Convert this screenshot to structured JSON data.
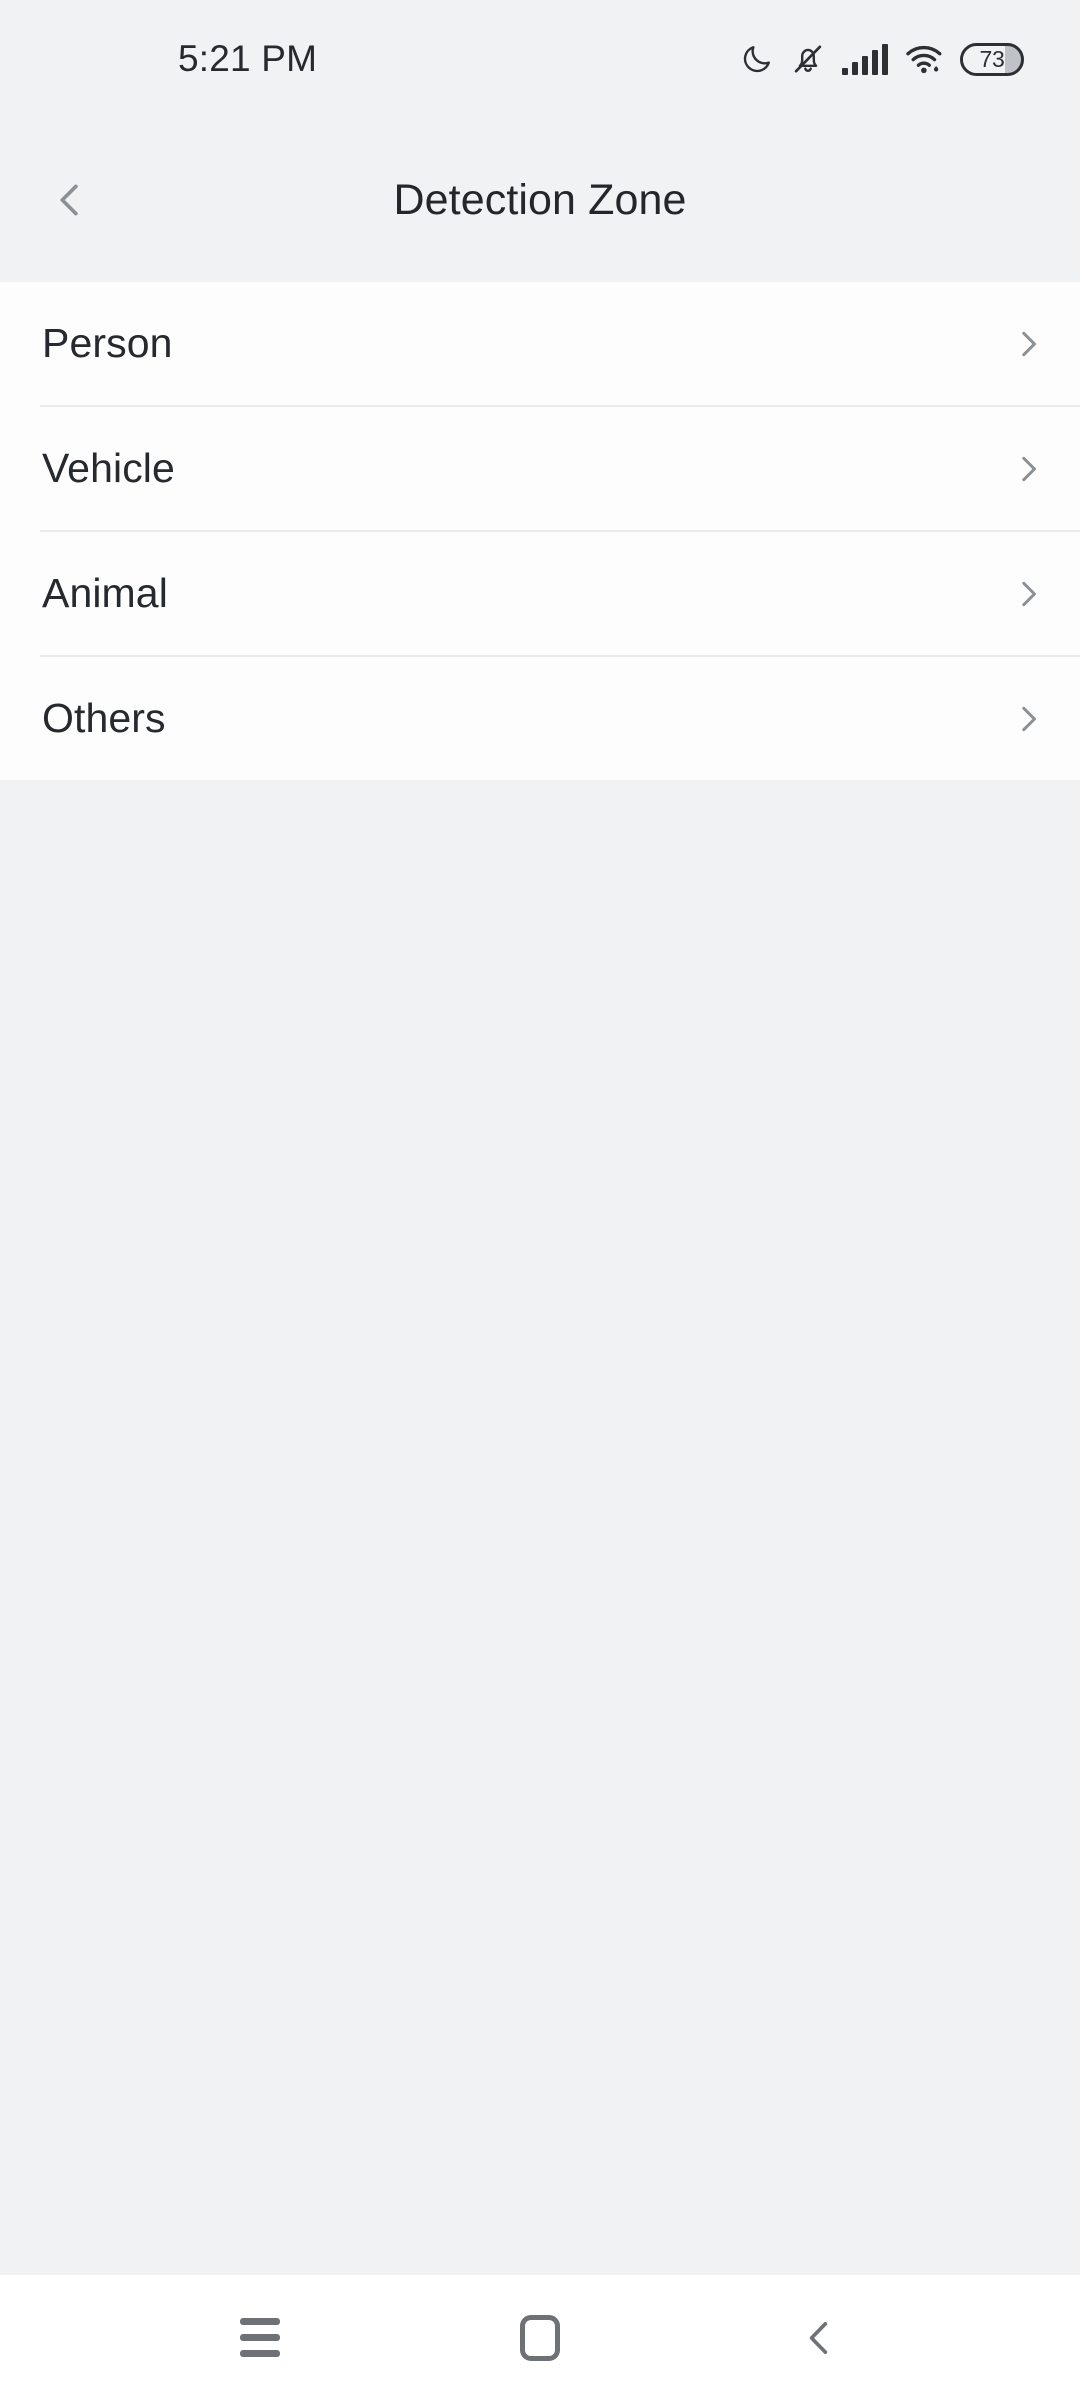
{
  "status_bar": {
    "time": "5:21 PM",
    "icons": [
      {
        "name": "do-not-disturb-moon-icon",
        "label": "Do Not Disturb"
      },
      {
        "name": "bell-muted-icon",
        "label": "Ringer Muted"
      },
      {
        "name": "cellular-signal-icon",
        "label": "Signal",
        "bars": 4
      },
      {
        "name": "wifi-icon",
        "label": "Wi-Fi"
      },
      {
        "name": "battery-icon",
        "label": "Battery"
      }
    ],
    "battery_level": "73"
  },
  "app_bar": {
    "back_label": "Back",
    "title": "Detection Zone"
  },
  "list": {
    "items": [
      {
        "label": "Person",
        "chevron": "chevron-right-icon"
      },
      {
        "label": "Vehicle",
        "chevron": "chevron-right-icon"
      },
      {
        "label": "Animal",
        "chevron": "chevron-right-icon"
      },
      {
        "label": "Others",
        "chevron": "chevron-right-icon"
      }
    ]
  },
  "nav_bar": {
    "recents_label": "Recents",
    "home_label": "Home",
    "back_label": "Back"
  },
  "colors": {
    "background": "#f1f2f4",
    "card": "#fdfdfe",
    "divider": "#e9eaec",
    "text_primary": "#26292d",
    "icon_gray": "#8b9095",
    "nav_icon": "#6e7276",
    "status_icon": "#2c3034"
  }
}
